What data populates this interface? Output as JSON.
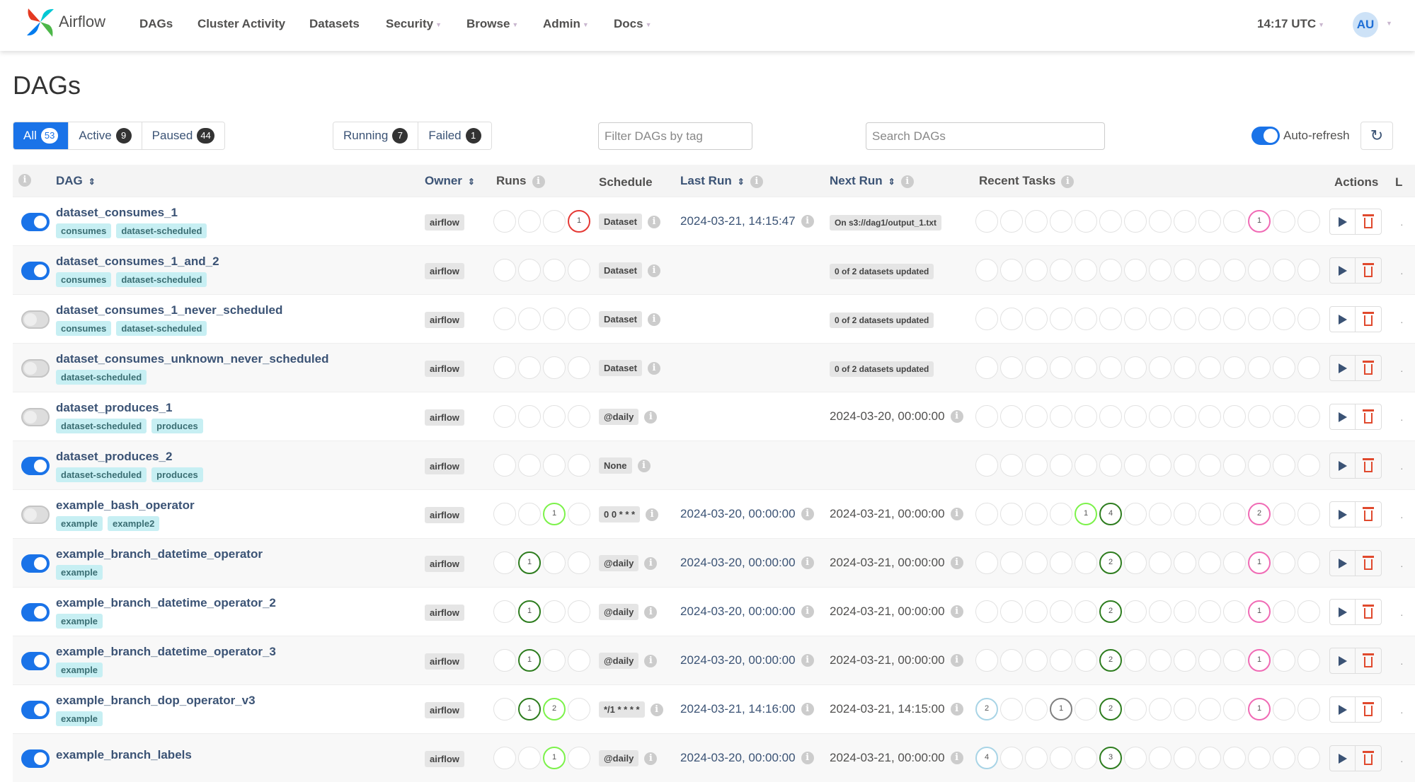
{
  "nav": {
    "brand": "Airflow",
    "items": [
      {
        "label": "DAGs",
        "dropdown": false
      },
      {
        "label": "Cluster Activity",
        "dropdown": false
      },
      {
        "label": "Datasets",
        "dropdown": false
      },
      {
        "label": "Security",
        "dropdown": true
      },
      {
        "label": "Browse",
        "dropdown": true
      },
      {
        "label": "Admin",
        "dropdown": true
      },
      {
        "label": "Docs",
        "dropdown": true
      }
    ],
    "clock": "14:17 UTC",
    "user_initials": "AU"
  },
  "page_title": "DAGs",
  "status_filters": [
    {
      "label": "All",
      "count": "53",
      "active": true
    },
    {
      "label": "Active",
      "count": "9",
      "active": false
    },
    {
      "label": "Paused",
      "count": "44",
      "active": false
    }
  ],
  "state_filters": [
    {
      "label": "Running",
      "count": "7"
    },
    {
      "label": "Failed",
      "count": "1"
    }
  ],
  "tag_filter": {
    "placeholder": "Filter DAGs by tag",
    "value": ""
  },
  "search": {
    "placeholder": "Search DAGs",
    "value": ""
  },
  "auto_refresh": {
    "label": "Auto-refresh",
    "enabled": true
  },
  "columns": {
    "dag": "DAG",
    "owner": "Owner",
    "runs": "Runs",
    "schedule": "Schedule",
    "last_run": "Last Run",
    "next_run": "Next Run",
    "recent_tasks": "Recent Tasks",
    "actions": "Actions",
    "links": "L"
  },
  "state_colors": {
    "failed": "#e53935",
    "running": "#7cf24a",
    "success": "#2e7d1f",
    "skipped": "#f06bb5",
    "queued": "#808080",
    "scheduled": "#a8d4e6",
    "empty": "#e2e2e2"
  },
  "rows": [
    {
      "name": "dataset_consumes_1",
      "active": true,
      "tags": [
        "consumes",
        "dataset-scheduled"
      ],
      "owner": "airflow",
      "runs": [
        null,
        null,
        null,
        {
          "count": "1",
          "state": "failed"
        }
      ],
      "schedule": "Dataset",
      "last_run": "2024-03-21, 14:15:47",
      "next_run": "On s3://dag1/output_1.txt",
      "next_run_is_badge": true,
      "recent_tasks": [
        null,
        null,
        null,
        null,
        null,
        null,
        null,
        null,
        null,
        null,
        null,
        {
          "count": "1",
          "state": "skipped"
        },
        null,
        null
      ]
    },
    {
      "name": "dataset_consumes_1_and_2",
      "active": true,
      "tags": [
        "consumes",
        "dataset-scheduled"
      ],
      "owner": "airflow",
      "runs": [
        null,
        null,
        null,
        null
      ],
      "schedule": "Dataset",
      "last_run": "",
      "next_run": "0 of 2 datasets updated",
      "next_run_is_badge": true,
      "recent_tasks": [
        null,
        null,
        null,
        null,
        null,
        null,
        null,
        null,
        null,
        null,
        null,
        null,
        null,
        null
      ]
    },
    {
      "name": "dataset_consumes_1_never_scheduled",
      "active": false,
      "tags": [
        "consumes",
        "dataset-scheduled"
      ],
      "owner": "airflow",
      "runs": [
        null,
        null,
        null,
        null
      ],
      "schedule": "Dataset",
      "last_run": "",
      "next_run": "0 of 2 datasets updated",
      "next_run_is_badge": true,
      "recent_tasks": [
        null,
        null,
        null,
        null,
        null,
        null,
        null,
        null,
        null,
        null,
        null,
        null,
        null,
        null
      ]
    },
    {
      "name": "dataset_consumes_unknown_never_scheduled",
      "active": false,
      "tags": [
        "dataset-scheduled"
      ],
      "owner": "airflow",
      "runs": [
        null,
        null,
        null,
        null
      ],
      "schedule": "Dataset",
      "last_run": "",
      "next_run": "0 of 2 datasets updated",
      "next_run_is_badge": true,
      "recent_tasks": [
        null,
        null,
        null,
        null,
        null,
        null,
        null,
        null,
        null,
        null,
        null,
        null,
        null,
        null
      ]
    },
    {
      "name": "dataset_produces_1",
      "active": false,
      "tags": [
        "dataset-scheduled",
        "produces"
      ],
      "owner": "airflow",
      "runs": [
        null,
        null,
        null,
        null
      ],
      "schedule": "@daily",
      "last_run": "",
      "next_run": "2024-03-20, 00:00:00",
      "next_run_is_badge": false,
      "recent_tasks": [
        null,
        null,
        null,
        null,
        null,
        null,
        null,
        null,
        null,
        null,
        null,
        null,
        null,
        null
      ]
    },
    {
      "name": "dataset_produces_2",
      "active": true,
      "tags": [
        "dataset-scheduled",
        "produces"
      ],
      "owner": "airflow",
      "runs": [
        null,
        null,
        null,
        null
      ],
      "schedule": "None",
      "last_run": "",
      "next_run": "",
      "next_run_is_badge": false,
      "recent_tasks": [
        null,
        null,
        null,
        null,
        null,
        null,
        null,
        null,
        null,
        null,
        null,
        null,
        null,
        null
      ]
    },
    {
      "name": "example_bash_operator",
      "active": false,
      "tags": [
        "example",
        "example2"
      ],
      "owner": "airflow",
      "runs": [
        null,
        null,
        {
          "count": "1",
          "state": "running"
        },
        null
      ],
      "schedule": "0 0 * * *",
      "last_run": "2024-03-20, 00:00:00",
      "next_run": "2024-03-21, 00:00:00",
      "next_run_is_badge": false,
      "recent_tasks": [
        null,
        null,
        null,
        null,
        {
          "count": "1",
          "state": "running"
        },
        {
          "count": "4",
          "state": "success"
        },
        null,
        null,
        null,
        null,
        null,
        {
          "count": "2",
          "state": "skipped"
        },
        null,
        null
      ]
    },
    {
      "name": "example_branch_datetime_operator",
      "active": true,
      "tags": [
        "example"
      ],
      "owner": "airflow",
      "runs": [
        null,
        {
          "count": "1",
          "state": "success"
        },
        null,
        null
      ],
      "schedule": "@daily",
      "last_run": "2024-03-20, 00:00:00",
      "next_run": "2024-03-21, 00:00:00",
      "next_run_is_badge": false,
      "recent_tasks": [
        null,
        null,
        null,
        null,
        null,
        {
          "count": "2",
          "state": "success"
        },
        null,
        null,
        null,
        null,
        null,
        {
          "count": "1",
          "state": "skipped"
        },
        null,
        null
      ]
    },
    {
      "name": "example_branch_datetime_operator_2",
      "active": true,
      "tags": [
        "example"
      ],
      "owner": "airflow",
      "runs": [
        null,
        {
          "count": "1",
          "state": "success"
        },
        null,
        null
      ],
      "schedule": "@daily",
      "last_run": "2024-03-20, 00:00:00",
      "next_run": "2024-03-21, 00:00:00",
      "next_run_is_badge": false,
      "recent_tasks": [
        null,
        null,
        null,
        null,
        null,
        {
          "count": "2",
          "state": "success"
        },
        null,
        null,
        null,
        null,
        null,
        {
          "count": "1",
          "state": "skipped"
        },
        null,
        null
      ]
    },
    {
      "name": "example_branch_datetime_operator_3",
      "active": true,
      "tags": [
        "example"
      ],
      "owner": "airflow",
      "runs": [
        null,
        {
          "count": "1",
          "state": "success"
        },
        null,
        null
      ],
      "schedule": "@daily",
      "last_run": "2024-03-20, 00:00:00",
      "next_run": "2024-03-21, 00:00:00",
      "next_run_is_badge": false,
      "recent_tasks": [
        null,
        null,
        null,
        null,
        null,
        {
          "count": "2",
          "state": "success"
        },
        null,
        null,
        null,
        null,
        null,
        {
          "count": "1",
          "state": "skipped"
        },
        null,
        null
      ]
    },
    {
      "name": "example_branch_dop_operator_v3",
      "active": true,
      "tags": [
        "example"
      ],
      "owner": "airflow",
      "runs": [
        null,
        {
          "count": "1",
          "state": "success"
        },
        {
          "count": "2",
          "state": "running"
        },
        null
      ],
      "schedule": "*/1 * * * *",
      "last_run": "2024-03-21, 14:16:00",
      "next_run": "2024-03-21, 14:15:00",
      "next_run_is_badge": false,
      "recent_tasks": [
        {
          "count": "2",
          "state": "scheduled"
        },
        null,
        null,
        {
          "count": "1",
          "state": "queued"
        },
        null,
        {
          "count": "2",
          "state": "success"
        },
        null,
        null,
        null,
        null,
        null,
        {
          "count": "1",
          "state": "skipped"
        },
        null,
        null
      ]
    },
    {
      "name": "example_branch_labels",
      "active": true,
      "tags": [],
      "owner": "airflow",
      "runs": [
        null,
        null,
        {
          "count": "1",
          "state": "running"
        },
        null
      ],
      "schedule": "@daily",
      "last_run": "2024-03-20, 00:00:00",
      "next_run": "2024-03-21, 00:00:00",
      "next_run_is_badge": false,
      "recent_tasks": [
        {
          "count": "4",
          "state": "scheduled"
        },
        null,
        null,
        null,
        null,
        {
          "count": "3",
          "state": "success"
        },
        null,
        null,
        null,
        null,
        null,
        null,
        null,
        null
      ]
    }
  ]
}
